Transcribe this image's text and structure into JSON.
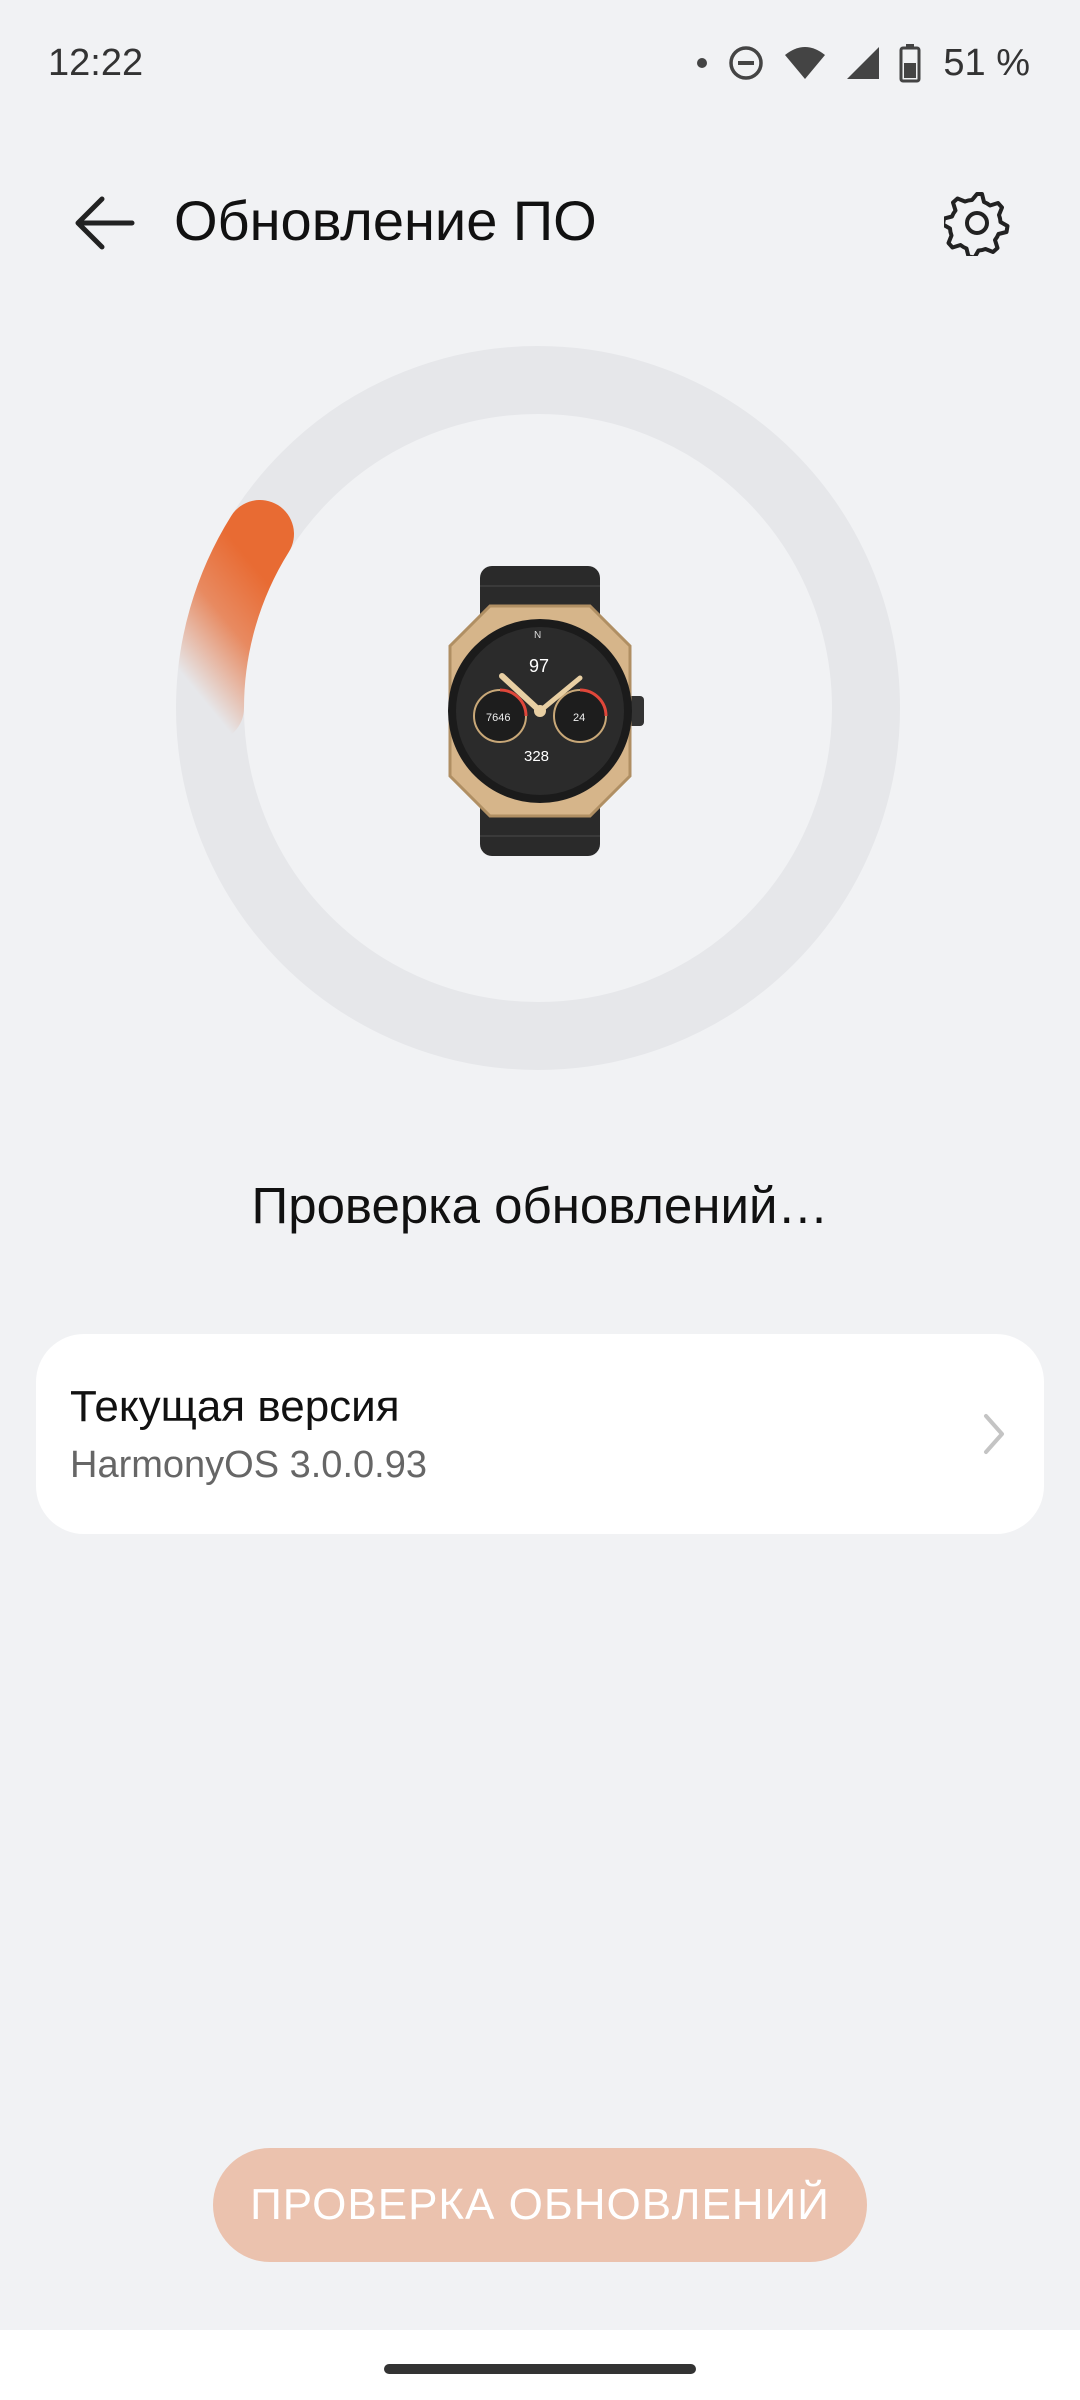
{
  "status_bar": {
    "time": "12:22",
    "battery": "51 %",
    "icons": [
      "notification-dot-icon",
      "do-not-disturb-icon",
      "wifi-icon",
      "cellular-signal-icon",
      "battery-icon"
    ]
  },
  "header": {
    "title": "Обновление ПО",
    "back_icon": "arrow-left-icon",
    "settings_icon": "gear-icon"
  },
  "progress": {
    "status_text": "Проверка обновлений…",
    "accent_color": "#e86b33",
    "track_color": "#e6e7ea"
  },
  "watch_face": {
    "top_number": "97",
    "center_number": "328",
    "left_dial": "7646",
    "right_dial": "24"
  },
  "version_card": {
    "title": "Текущая версия",
    "value": "HarmonyOS 3.0.0.93"
  },
  "footer": {
    "button_label": "ПРОВЕРКА ОБНОВЛЕНИЙ",
    "button_color": "#ebc2ae"
  }
}
